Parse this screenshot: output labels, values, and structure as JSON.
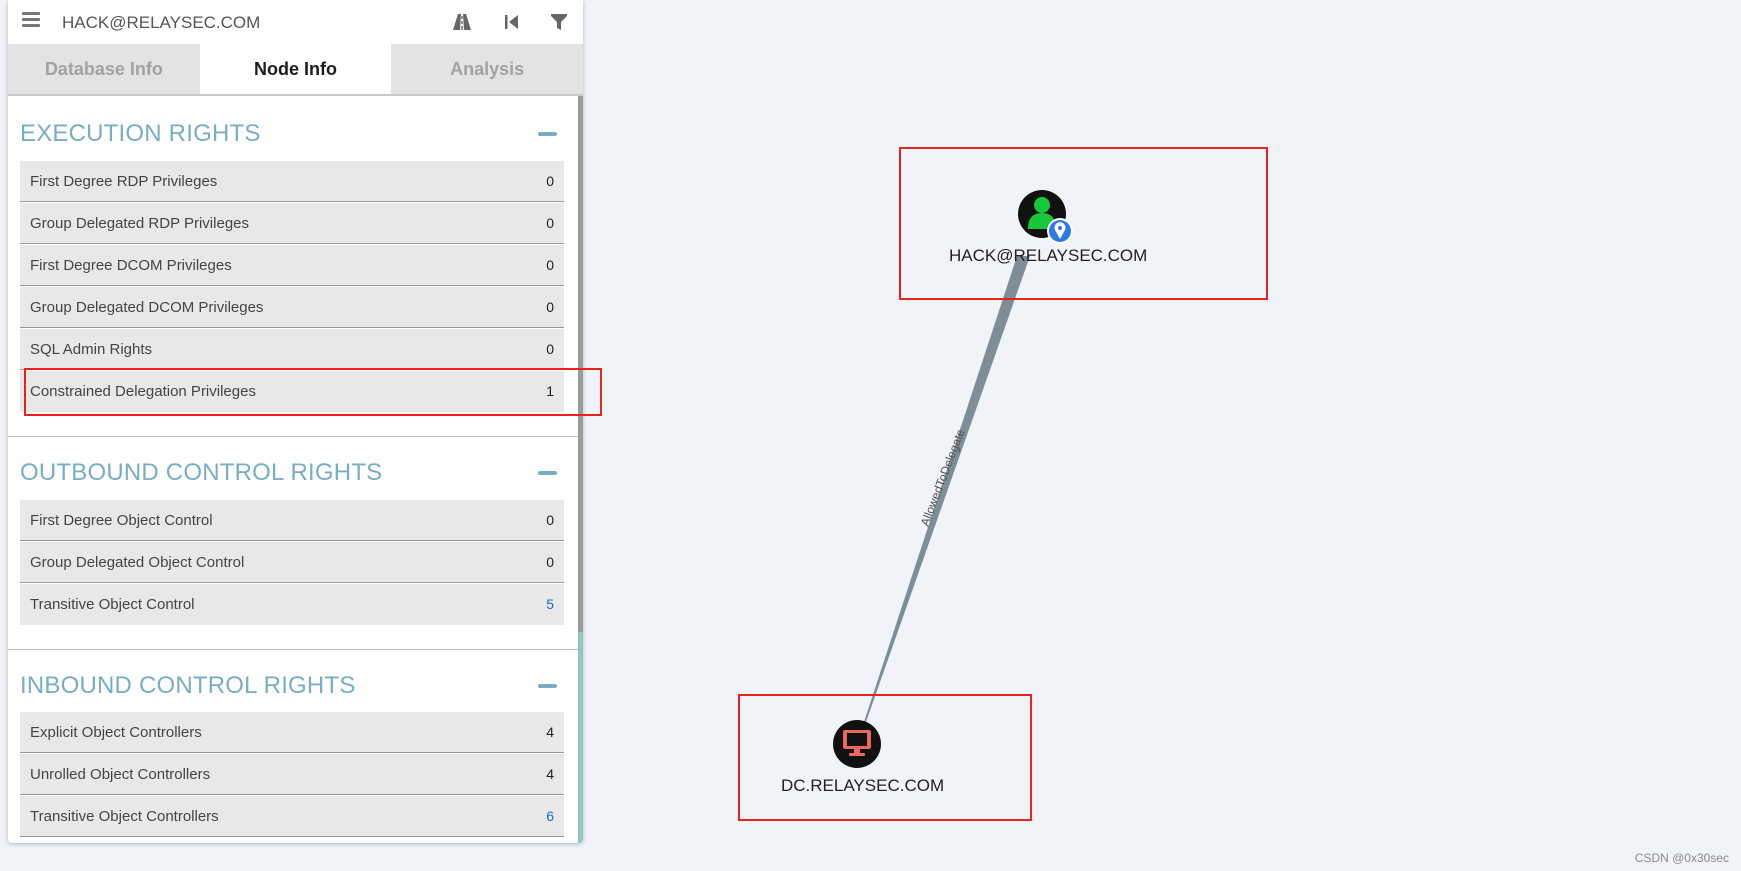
{
  "search": {
    "value": "HACK@RELAYSEC.COM"
  },
  "toolbar": {
    "icons": [
      "pathfinding-icon",
      "back-icon",
      "filter-icon"
    ]
  },
  "tabs": [
    {
      "label": "Database Info",
      "active": false
    },
    {
      "label": "Node Info",
      "active": true
    },
    {
      "label": "Analysis",
      "active": false
    }
  ],
  "sections": {
    "execution": {
      "title": "EXECUTION RIGHTS",
      "rows": [
        {
          "label": "First Degree RDP Privileges",
          "value": "0"
        },
        {
          "label": "Group Delegated RDP Privileges",
          "value": "0"
        },
        {
          "label": "First Degree DCOM Privileges",
          "value": "0"
        },
        {
          "label": "Group Delegated DCOM Privileges",
          "value": "0"
        },
        {
          "label": "SQL Admin Rights",
          "value": "0"
        },
        {
          "label": "Constrained Delegation Privileges",
          "value": "1"
        }
      ]
    },
    "outbound": {
      "title": "OUTBOUND CONTROL RIGHTS",
      "rows": [
        {
          "label": "First Degree Object Control",
          "value": "0"
        },
        {
          "label": "Group Delegated Object Control",
          "value": "0"
        },
        {
          "label": "Transitive Object Control",
          "value": "5"
        }
      ]
    },
    "inbound": {
      "title": "INBOUND CONTROL RIGHTS",
      "rows": [
        {
          "label": "Explicit Object Controllers",
          "value": "4"
        },
        {
          "label": "Unrolled Object Controllers",
          "value": "4"
        },
        {
          "label": "Transitive Object Controllers",
          "value": "6"
        }
      ]
    }
  },
  "graph": {
    "user_node": {
      "label": "HACK@RELAYSEC.COM",
      "icon": "user-icon",
      "color": "#17c93a"
    },
    "computer_node": {
      "label": "DC.RELAYSEC.COM",
      "icon": "computer-icon",
      "color": "#e8695d"
    },
    "edge": {
      "label": "AllowedToDelegate"
    }
  },
  "watermark": "CSDN @0x30sec",
  "colors": {
    "highlight": "#e8221c",
    "section_title": "#79aec2",
    "link_value": "#1a6fbf"
  }
}
